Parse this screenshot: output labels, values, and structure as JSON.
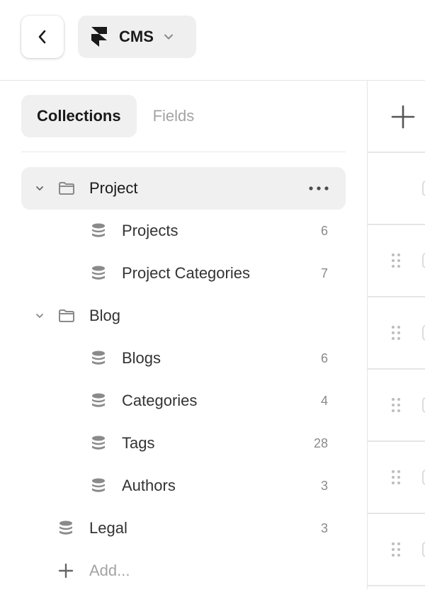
{
  "header": {
    "back_icon": "chevron-left-icon",
    "app_logo": "framer-logo-icon",
    "app_label": "CMS",
    "dropdown_icon": "chevron-down-icon"
  },
  "tabs": [
    {
      "label": "Collections",
      "active": true
    },
    {
      "label": "Fields",
      "active": false
    }
  ],
  "tree": {
    "project_folder": {
      "label": "Project",
      "expanded": true,
      "selected": true
    },
    "projects": {
      "label": "Projects",
      "count": "6"
    },
    "project_categories": {
      "label": "Project Categories",
      "count": "7"
    },
    "blog_folder": {
      "label": "Blog",
      "expanded": true
    },
    "blogs": {
      "label": "Blogs",
      "count": "6"
    },
    "categories": {
      "label": "Categories",
      "count": "4"
    },
    "tags": {
      "label": "Tags",
      "count": "28"
    },
    "authors": {
      "label": "Authors",
      "count": "3"
    },
    "legal": {
      "label": "Legal",
      "count": "3"
    },
    "add": {
      "label": "Add..."
    }
  },
  "right_pane": {
    "add_icon": "plus-icon",
    "drag_icon": "drag-handle-icon"
  }
}
